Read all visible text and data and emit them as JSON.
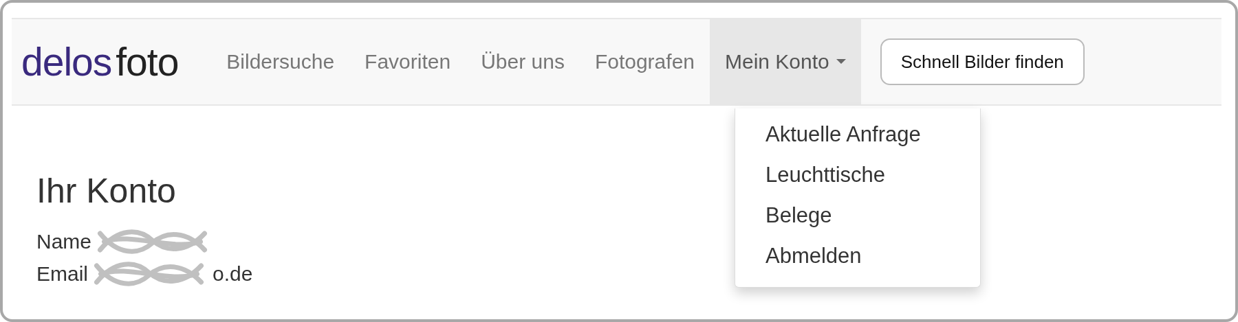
{
  "navbar": {
    "logo": [
      {
        "text": "delos",
        "color": "#3a2a7e"
      },
      {
        "text": "foto",
        "color": "#222222"
      }
    ],
    "items": [
      {
        "label": "Bildersuche",
        "selected": false,
        "dropdown": false
      },
      {
        "label": "Favoriten",
        "selected": false,
        "dropdown": false
      },
      {
        "label": "Über uns",
        "selected": false,
        "dropdown": false
      },
      {
        "label": "Fotografen",
        "selected": false,
        "dropdown": false
      },
      {
        "label": "Mein Konto",
        "selected": true,
        "dropdown": true
      }
    ],
    "button": "Schnell Bilder finden"
  },
  "dropdown_menu": {
    "items": [
      "Aktuelle Anfrage",
      "Leuchttische",
      "Belege",
      "Abmelden"
    ]
  },
  "account": {
    "title": "Ihr Konto",
    "fields": [
      {
        "label": "Name",
        "redacted": true
      },
      {
        "label": "Email",
        "redacted": true,
        "visible_tail": "o.de"
      }
    ]
  }
}
